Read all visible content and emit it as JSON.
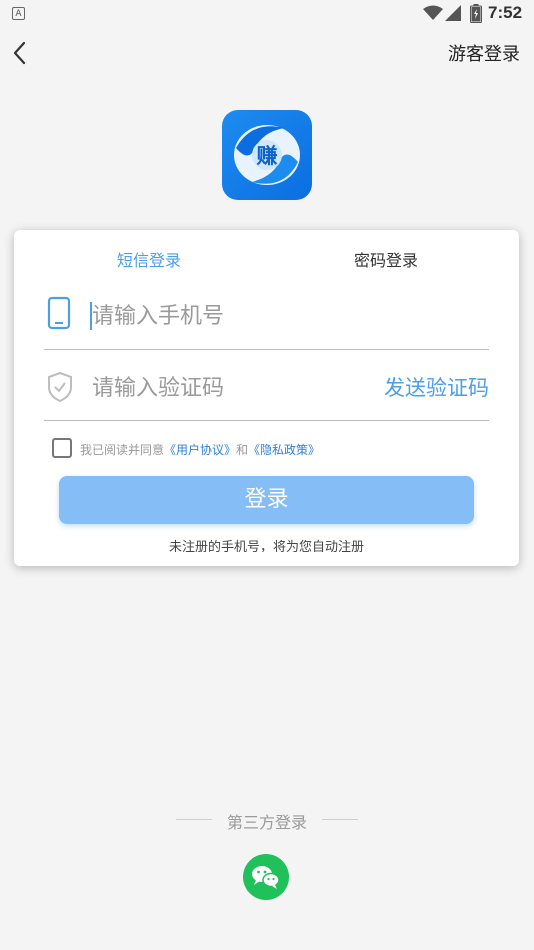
{
  "status_bar": {
    "notification_icon": "A",
    "time": "7:52",
    "icons": [
      "wifi-icon",
      "signal-icon",
      "battery-icon"
    ]
  },
  "header": {
    "back_icon": "chevron-left-icon",
    "guest_login": "游客登录"
  },
  "app": {
    "logo_text": "赚",
    "logo_color": "#1d8cf0"
  },
  "login_card": {
    "tabs": [
      {
        "label": "短信登录",
        "active": true
      },
      {
        "label": "密码登录",
        "active": false
      }
    ],
    "phone_field": {
      "placeholder": "请输入手机号",
      "value": ""
    },
    "code_field": {
      "placeholder": "请输入验证码",
      "value": ""
    },
    "send_code": "发送验证码",
    "agreement": {
      "checked": false,
      "prefix": "我已阅读并同意",
      "user_agreement": "《用户协议》",
      "and": "和",
      "privacy_policy": "《隐私政策》"
    },
    "login_button": "登录",
    "auto_register_note": "未注册的手机号，将为您自动注册"
  },
  "third_party": {
    "title": "第三方登录",
    "providers": [
      "wechat-icon"
    ]
  },
  "colors": {
    "accent": "#4a9fe8",
    "button": "#85bdf7",
    "wechat": "#20c05a",
    "link": "#2f80d8"
  }
}
